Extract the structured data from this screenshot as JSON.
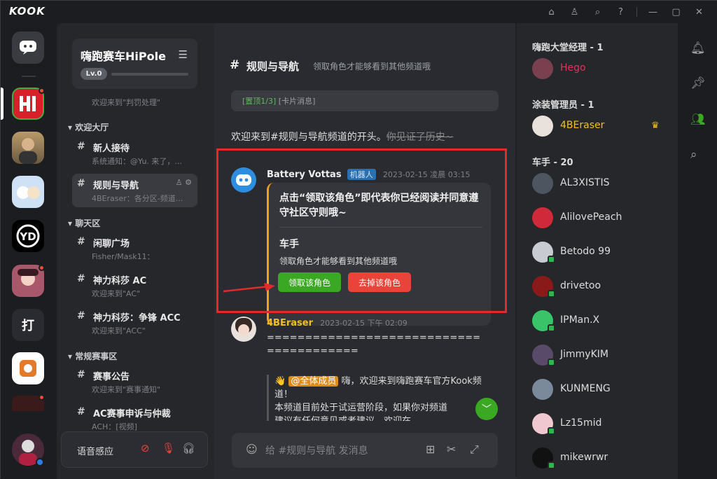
{
  "app": {
    "logo": "KOOK"
  },
  "guild": {
    "name": "嗨跑赛车HiPole",
    "level": "Lv.0"
  },
  "channels": {
    "system_line": "欢迎来到\"判罚处理\"",
    "categories": [
      {
        "label": "欢迎大厅",
        "items": [
          {
            "name": "新人接待",
            "sub": "系统通知：@Yu. 来了，..."
          },
          {
            "name": "规则与导航",
            "sub": "4BEraser：各分区-频道..."
          }
        ]
      },
      {
        "label": "聊天区",
        "items": [
          {
            "name": "闲聊广场",
            "sub": "Fisher/Mask11："
          },
          {
            "name": "神力科莎 AC",
            "sub": "欢迎来到\"AC\""
          },
          {
            "name": "神力科莎：争锋 ACC",
            "sub": "欢迎来到\"ACC\""
          }
        ]
      },
      {
        "label": "常规赛事区",
        "items": [
          {
            "name": "赛事公告",
            "sub": "欢迎来到\"赛事通知\""
          },
          {
            "name": "AC赛事申诉与仲裁",
            "sub": "ACH：[视频]"
          }
        ]
      }
    ]
  },
  "voice": {
    "label": "语音感应"
  },
  "header": {
    "hash": "#",
    "title": "规则与导航",
    "desc": "领取角色才能够看到其他频道哦"
  },
  "pinned": {
    "tag": "[置顶1/3]",
    "text": "[卡片消息]"
  },
  "welcome": {
    "main": "欢迎来到#规则与导航频道的开头。",
    "struck": "你见证了历史~"
  },
  "messages": [
    {
      "author": "Battery Vottas",
      "badge": "机器人",
      "time": "2023-02-15 凌晨 03:15",
      "card": {
        "title": "点击“领取该角色”即代表你已经阅读并同意遵守社区守则哦~",
        "role": "车手",
        "desc": "领取角色才能够看到其他频道哦",
        "btn_get": "领取该角色",
        "btn_remove": "去掉该角色"
      }
    },
    {
      "author": "4BEraser",
      "time": "2023-02-15 下午 02:09",
      "body1": "============================\n============",
      "mention": "@全体成员",
      "line1": "嗨，欢迎来到嗨跑赛车官方Kook频道！",
      "line2": "本频道目前处于试运营阶段，如果你对频道",
      "line3": "建议有任何意见或者建议，欢迎在"
    }
  ],
  "input": {
    "placeholder": "给 #规则与导航 发消息"
  },
  "members": {
    "roles": [
      {
        "label": "嗨跑大堂经理 - 1",
        "users": [
          {
            "name": "Hego",
            "color": "#e0315f"
          }
        ]
      },
      {
        "label": "涂装管理员 - 1",
        "users": [
          {
            "name": "4BEraser",
            "color": "#f0c020"
          }
        ]
      },
      {
        "label": "车手 - 20",
        "users": [
          {
            "name": "AL3XISTIS",
            "color": "#e8e8e8"
          },
          {
            "name": "AlilovePeach",
            "color": "#e8e8e8"
          },
          {
            "name": "Betodo 99",
            "color": "#e8e8e8"
          },
          {
            "name": "drivetoo",
            "color": "#e8e8e8"
          },
          {
            "name": "IPMan.X",
            "color": "#e8e8e8"
          },
          {
            "name": "JimmyKIM",
            "color": "#e8e8e8"
          },
          {
            "name": "KUNMENG",
            "color": "#e8e8e8"
          },
          {
            "name": "Lz15mid",
            "color": "#e8e8e8"
          },
          {
            "name": "mikewrwr",
            "color": "#e8e8e8"
          }
        ]
      }
    ]
  },
  "colors": {
    "accent": "#3aa822",
    "danger": "#e8443a",
    "highlight_box": "#e02b2b"
  }
}
